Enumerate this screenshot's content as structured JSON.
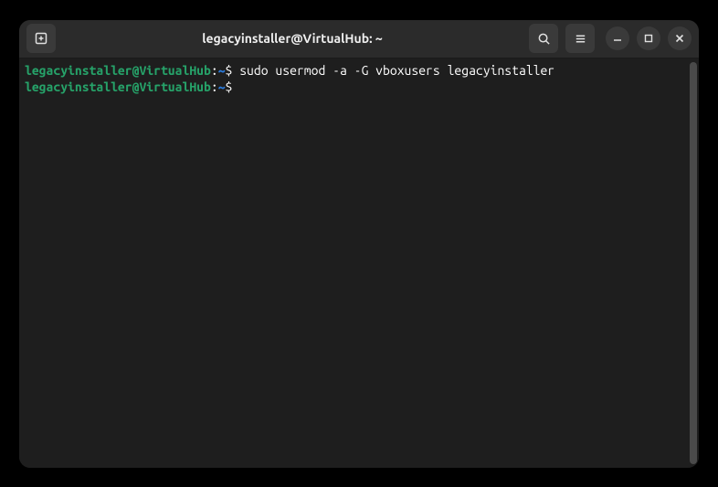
{
  "window": {
    "title": "legacyinstaller@VirtualHub: ~"
  },
  "terminal": {
    "lines": [
      {
        "user_host": "legacyinstaller@VirtualHub",
        "path": "~",
        "command": "sudo usermod -a -G vboxusers legacyinstaller"
      },
      {
        "user_host": "legacyinstaller@VirtualHub",
        "path": "~",
        "command": ""
      }
    ]
  },
  "icons": {
    "new_tab": "new-tab",
    "search": "search",
    "menu": "menu",
    "minimize": "minimize",
    "maximize": "maximize",
    "close": "close"
  }
}
